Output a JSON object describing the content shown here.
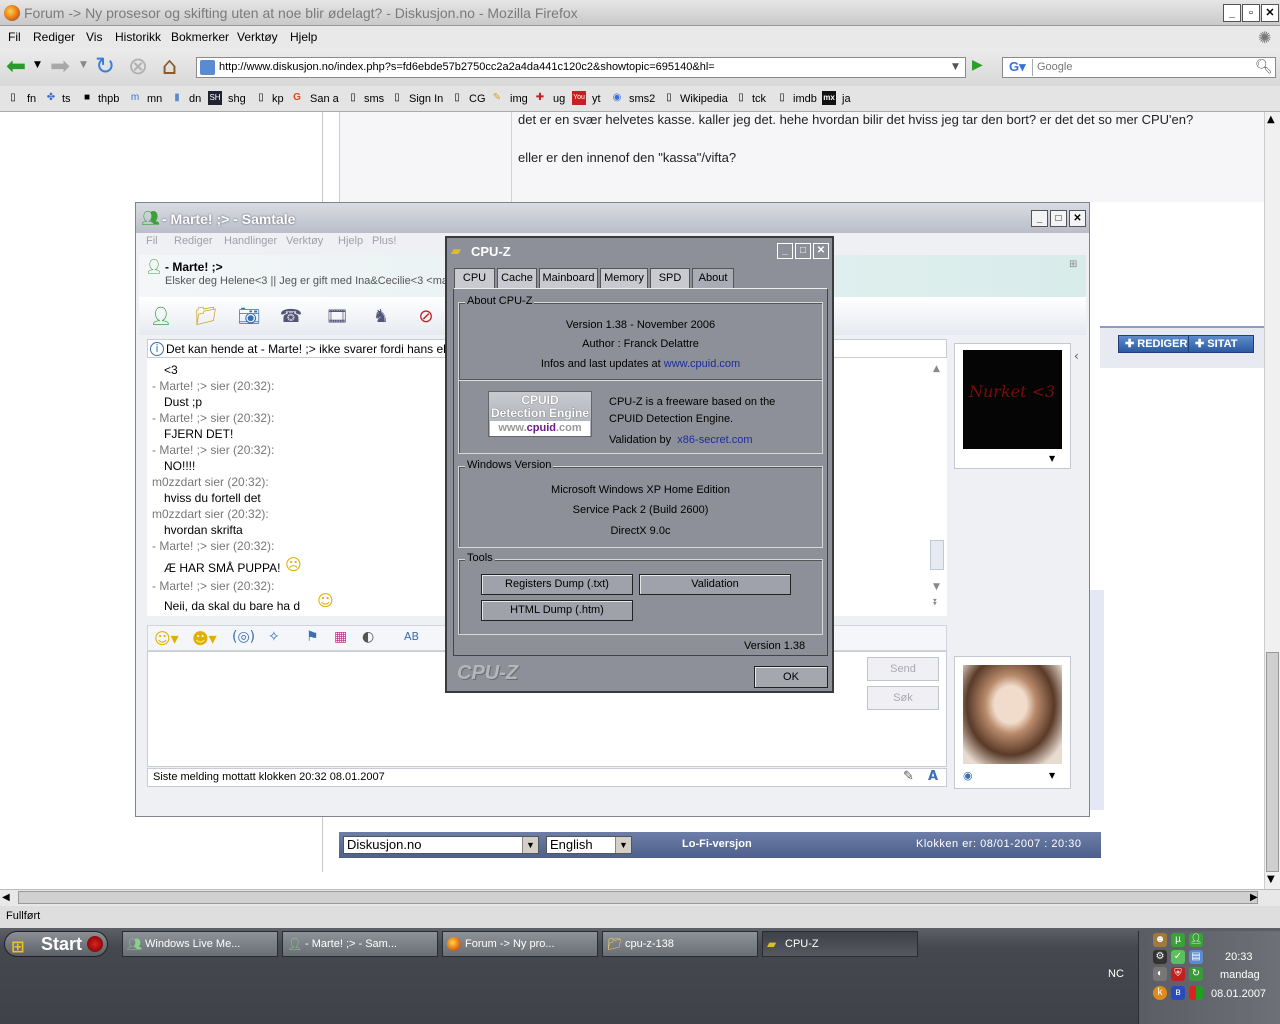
{
  "firefox": {
    "window_title": "Forum -> Ny prosesor og skifting uten at noe blir ødelagt? - Diskusjon.no - Mozilla Firefox",
    "menu": [
      "Fil",
      "Rediger",
      "Vis",
      "Historikk",
      "Bokmerker",
      "Verktøy",
      "Hjelp"
    ],
    "url": "http://www.diskusjon.no/index.php?s=fd6ebde57b2750cc2a2a4da441c120c2&showtopic=695140&hl=",
    "search_placeholder": "Google",
    "bookmarks": [
      "fn",
      "ts",
      "thpb",
      "mn",
      "dn",
      "shg",
      "kp",
      "San a",
      "sms",
      "Sign In",
      "CG",
      "img",
      "ug",
      "yt",
      "sms2",
      "Wikipedia",
      "tck",
      "imdb",
      "ja"
    ],
    "status": "Fullført"
  },
  "forum": {
    "post_line1": "det er en svær helvetes kasse. kaller jeg det. hehe hvordan bilir det hviss jeg tar den bort? er det det so mer CPU'en?",
    "post_line2": "eller er den innenof den \"kassa\"/vifta?",
    "btn_edit": "REDIGER",
    "btn_quote": "SITAT",
    "footer_select": "Diskusjon.no",
    "footer_lang": "English",
    "footer_lofi": "Lo-Fi-versjon",
    "footer_clock": "Klokken er: 08/01-2007 : 20:30"
  },
  "messenger": {
    "title": "- Marte! ;> - Samtale",
    "menu": [
      "Fil",
      "Rediger",
      "Handlinger",
      "Verktøy",
      "Hjelp",
      "Plus!"
    ],
    "contact_name": "- Marte! ;>",
    "contact_status": "Elsker deg Helene<3 || Jeg er gift med Ina&Cecilie<3 <ma",
    "info": "Det kan hende at - Marte! ;> ikke svarer fordi hans eller h",
    "conversation": [
      {
        "kind": "msg",
        "text": "<3"
      },
      {
        "kind": "hd",
        "text": "- Marte! ;> sier (20:32):"
      },
      {
        "kind": "msg",
        "text": "Dust ;p"
      },
      {
        "kind": "hd",
        "text": "- Marte! ;> sier (20:32):"
      },
      {
        "kind": "msg",
        "text": "FJERN DET!"
      },
      {
        "kind": "hd",
        "text": "- Marte! ;> sier (20:32):"
      },
      {
        "kind": "msg",
        "text": "NO!!!!"
      },
      {
        "kind": "hd",
        "text": "m0zzdart sier (20:32):"
      },
      {
        "kind": "msg",
        "text": "hviss du fortell det"
      },
      {
        "kind": "hd",
        "text": "m0zzdart sier (20:32):"
      },
      {
        "kind": "msg",
        "text": "hvordan skrifta"
      },
      {
        "kind": "hd",
        "text": "- Marte! ;> sier (20:32):"
      },
      {
        "kind": "msg",
        "text": "Æ HAR SMÅ PUPPA!"
      },
      {
        "kind": "hd",
        "text": "- Marte! ;> sier (20:32):"
      },
      {
        "kind": "msg",
        "text": "Neii, da skal du bare ha d"
      }
    ],
    "send": "Send",
    "search": "Søk",
    "last_message": "Siste melding mottatt klokken 20:32 08.01.2007",
    "display_pic_text": "Nurket <3"
  },
  "cpuz": {
    "title": "CPU-Z",
    "tabs": [
      "CPU",
      "Cache",
      "Mainboard",
      "Memory",
      "SPD",
      "About"
    ],
    "active_tab": "About",
    "about_label": "About CPU-Z",
    "version_line": "Version 1.38  -  November 2006",
    "author": "Author : Franck Delattre",
    "infos": "Infos and last updates at",
    "site": "www.cpuid.com",
    "logo_l1": "CPUID",
    "logo_l2": "Detection Engine",
    "logo_l3a": "www.",
    "logo_l3b": "cpuid",
    "logo_l3c": ".com",
    "freeware1": "CPU-Z is a freeware based on the",
    "freeware2": "CPUID Detection Engine.",
    "validation_by": "Validation by",
    "validation_site": "x86-secret.com",
    "win_label": "Windows Version",
    "win1": "Microsoft Windows XP Home Edition",
    "win2": "Service Pack 2 (Build 2600)",
    "win3": "DirectX 9.0c",
    "tools_label": "Tools",
    "btn_regdump": "Registers Dump (.txt)",
    "btn_validation": "Validation",
    "btn_htmldump": "HTML Dump (.htm)",
    "version_footer": "Version 1.38",
    "brand": "CPU-Z",
    "ok": "OK"
  },
  "taskbar": {
    "start": "Start",
    "tasks": [
      "Windows Live Me...",
      "- Marte! ;> - Sam...",
      "Forum -> Ny pro...",
      "cpu-z-138",
      "CPU-Z"
    ],
    "nc": "NC",
    "time": "20:33",
    "day": "mandag",
    "date": "08.01.2007"
  }
}
